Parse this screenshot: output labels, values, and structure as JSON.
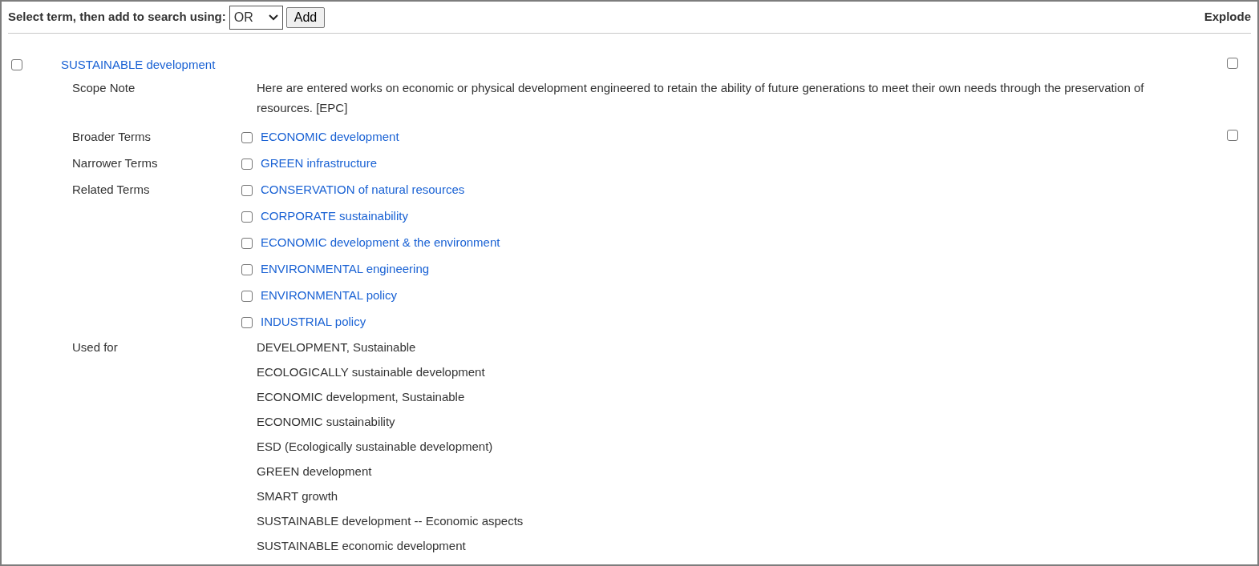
{
  "header": {
    "label": "Select term, then add to search using:",
    "operator": "OR",
    "add_button": "Add",
    "explode_label": "Explode"
  },
  "term": {
    "label": "SUSTAINABLE development",
    "checked": false,
    "explode_checked": false
  },
  "scope_note": {
    "label": "Scope Note",
    "text": "Here are entered works on economic or physical development engineered to retain the ability of future generations to meet their own needs through the preservation of resources. [EPC]"
  },
  "relations": [
    {
      "label": "Broader Terms",
      "terms": [
        {
          "label": "ECONOMIC development",
          "checked": false,
          "explode_checked": false
        }
      ]
    },
    {
      "label": "Narrower Terms",
      "terms": [
        {
          "label": "GREEN infrastructure",
          "checked": false
        }
      ]
    },
    {
      "label": "Related Terms",
      "terms": [
        {
          "label": "CONSERVATION of natural resources",
          "checked": false
        },
        {
          "label": "CORPORATE sustainability",
          "checked": false
        },
        {
          "label": "ECONOMIC development & the environment",
          "checked": false
        },
        {
          "label": "ENVIRONMENTAL engineering",
          "checked": false
        },
        {
          "label": "ENVIRONMENTAL policy",
          "checked": false
        },
        {
          "label": "INDUSTRIAL policy",
          "checked": false
        }
      ]
    }
  ],
  "used_for": {
    "label": "Used for",
    "terms": [
      "DEVELOPMENT, Sustainable",
      "ECOLOGICALLY sustainable development",
      "ECONOMIC development, Sustainable",
      "ECONOMIC sustainability",
      "ESD (Ecologically sustainable development)",
      "GREEN development",
      "SMART growth",
      "SUSTAINABLE development -- Economic aspects",
      "SUSTAINABLE economic development"
    ]
  }
}
